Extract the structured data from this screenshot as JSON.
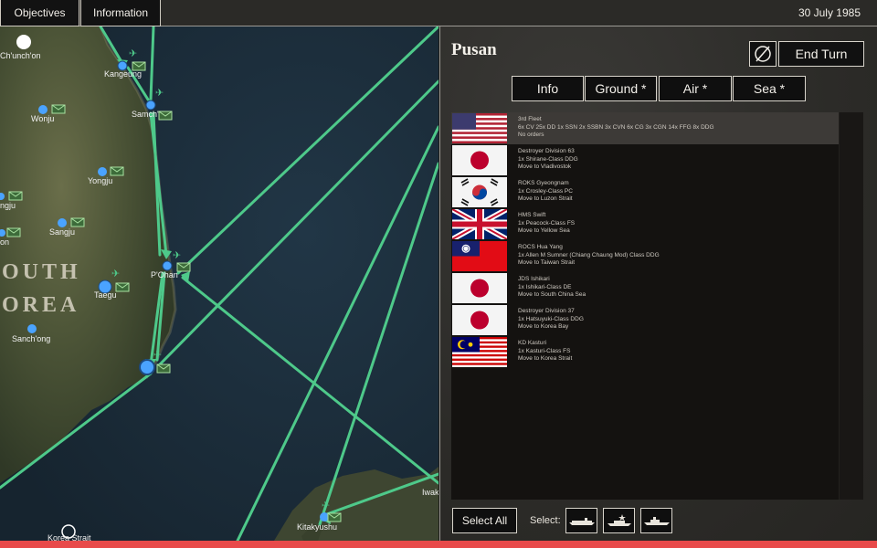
{
  "topbar": {
    "objectives_label": "Objectives",
    "information_label": "Information",
    "date": "30 July 1985"
  },
  "map": {
    "route_color": "#4ec98a",
    "base_color": "#4aa3ff",
    "cities": [
      "Ch'unch'on",
      "Kangeung",
      "Samch'ok",
      "Wonju",
      "Yongju",
      "Sangju",
      "Taegu",
      "P'Ohan",
      "Sanch'ong",
      "Kitakyushu"
    ],
    "cut_labels": [
      "ngju",
      "on",
      "Iwak",
      "Korea Strait"
    ],
    "region_label_line1": "OUTH",
    "region_label_line2": "OREA"
  },
  "panel": {
    "port_name": "Pusan",
    "end_turn_label": "End Turn",
    "tabs": [
      "Info",
      "Ground *",
      "Air *",
      "Sea *"
    ],
    "units": [
      {
        "flag": "usa",
        "name": "3rd Fleet",
        "composition": "6x CV 25x DD 1x SSN 2x SSBN 3x CVN 6x CG 3x CGN 14x FFG 8x DDG",
        "orders": "No orders",
        "selected": true
      },
      {
        "flag": "japan",
        "name": "Destroyer Division 63",
        "composition": "1x Shirane-Class DDG",
        "orders": "Move to Vladivostok",
        "selected": false
      },
      {
        "flag": "south-korea",
        "name": "ROKS Gyeongnam",
        "composition": "1x Crosley-Class PC",
        "orders": "Move to Luzon Strait",
        "selected": false
      },
      {
        "flag": "uk",
        "name": "HMS Swift",
        "composition": "1x Peacock-Class FS",
        "orders": "Move to Yellow Sea",
        "selected": false
      },
      {
        "flag": "taiwan",
        "name": "ROCS Hua Yang",
        "composition": "1x Allen M Sumner (Chiang Chaung Mod) Class DDG",
        "orders": "Move to Taiwan Strait",
        "selected": false
      },
      {
        "flag": "japan",
        "name": "JDS Ishikari",
        "composition": "1x Ishikari-Class DE",
        "orders": "Move to South China Sea",
        "selected": false
      },
      {
        "flag": "japan",
        "name": "Destroyer Division 37",
        "composition": "1x Hatsuyuki-Class DDG",
        "orders": "Move to Korea Bay",
        "selected": false
      },
      {
        "flag": "malaysia",
        "name": "KD Kasturi",
        "composition": "1x Kasturi-Class FS",
        "orders": "Move to Korea Strait",
        "selected": false
      }
    ],
    "select_all_label": "Select All",
    "select_label": "Select:",
    "select_icons": [
      "carrier-icon",
      "aircraft-ship-icon",
      "warship-icon"
    ]
  },
  "colors": {
    "accent_red": "#e84a4a",
    "panel_bg": "#2c2b28",
    "selected_row": "#3d3a37"
  }
}
